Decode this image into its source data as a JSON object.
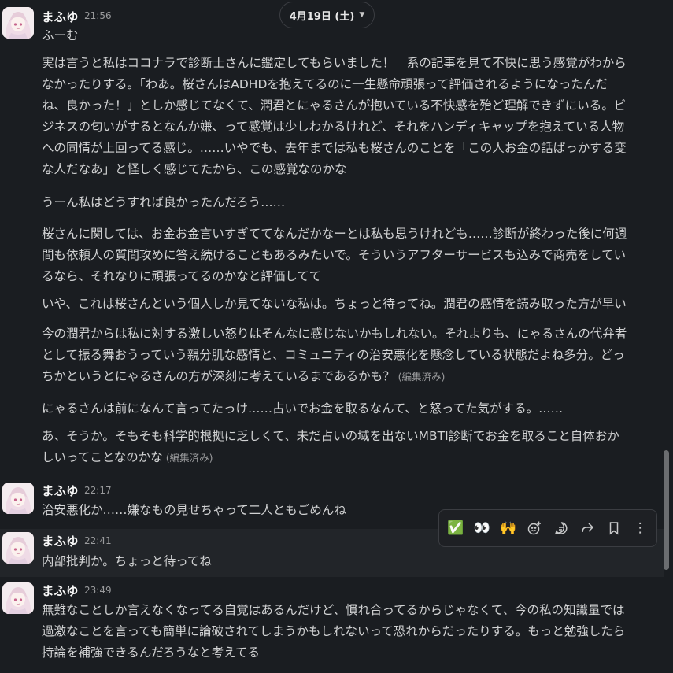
{
  "date_divider": {
    "label": "4月19日 (土)",
    "chevron": "chevron-down-icon"
  },
  "messages": [
    {
      "author": "まふゆ",
      "time": "21:56",
      "paragraphs": [
        {
          "lines": [
            "ふーむ"
          ]
        },
        {
          "lines": [
            "実は言うと私はココナラで診断士さんに鑑定してもらいました！　系の記事を見て不快に思う感覚がわから",
            "なかったりする。「わあ。桜さんはADHDを抱えてるのに一生懸命頑張って評価されるようになったんだ",
            "ね、良かった！」としか感じてなくて、潤君とにゃるさんが抱いている不快感を殆ど理解できずにいる。ビ",
            "ジネスの匂いがするとなんか嫌、って感覚は少しわかるけれど、それをハンディキャップを抱えている人物",
            "への同情が上回ってる感じ。……いやでも、去年までは私も桜さんのことを「この人お金の話ばっかする変",
            "な人だなあ」と怪しく感じてたから、この感覚なのかな"
          ]
        },
        {
          "lines": [
            "うーん私はどうすれば良かったんだろう……"
          ]
        },
        {
          "lines": [
            "桜さんに関しては、お金お金言いすぎててなんだかなーとは私も思うけれども……診断が終わった後に何週",
            "間も依頼人の質問攻めに答え続けることもあるみたいで。そういうアフターサービスも込みで商売をしてい",
            "るなら、それなりに頑張ってるのかなと評価してて"
          ]
        },
        {
          "lines": [
            "いや、これは桜さんという個人しか見てないな私は。ちょっと待ってね。潤君の感情を読み取った方が早い"
          ]
        },
        {
          "lines": [
            "今の潤君からは私に対する激しい怒りはそんなに感じないかもしれない。それよりも、にゃるさんの代弁者",
            "として振る舞おうっていう親分肌な感情と、コミュニティの治安悪化を懸念している状態だよね多分。どっ",
            "ちかというとにゃるさんの方が深刻に考えているまであるかも？"
          ],
          "edited": "(編集済み)"
        },
        {
          "lines": [
            "にゃるさんは前になんて言ってたっけ……占いでお金を取るなんて、と怒ってた気がする。……"
          ]
        },
        {
          "lines": [
            "あ、そうか。そもそも科学的根拠に乏しくて、未だ占いの域を出ないMBTI診断でお金を取ること自体おか",
            "しいってことなのかな"
          ],
          "edited": "(編集済み)"
        }
      ]
    },
    {
      "author": "まふゆ",
      "time": "22:17",
      "paragraphs": [
        {
          "lines": [
            "治安悪化か……嫌なもの見せちゃって二人ともごめんね"
          ]
        }
      ]
    },
    {
      "author": "まふゆ",
      "time": "22:41",
      "paragraphs": [
        {
          "lines": [
            "内部批判か。ちょっと待ってね"
          ]
        }
      ]
    },
    {
      "author": "まふゆ",
      "time": "23:49",
      "paragraphs": [
        {
          "lines": [
            "無難なことしか言えなくなってる自覚はあるんだけど、慣れ合ってるからじゃなくて、今の私の知識量では",
            "過激なことを言っても簡単に論破されてしまうかもしれないって恐れからだったりする。もっと勉強したら",
            "持論を補強できるんだろうなと考えてる"
          ]
        }
      ]
    }
  ],
  "toolbar": {
    "items": [
      {
        "name": "reaction-check-mark",
        "glyph": "✅"
      },
      {
        "name": "reaction-eyes",
        "glyph": "👀"
      },
      {
        "name": "reaction-raised-hands",
        "glyph": "🙌"
      },
      {
        "name": "add-reaction-icon",
        "glyph": ""
      },
      {
        "name": "reply-in-thread-icon",
        "glyph": ""
      },
      {
        "name": "forward-icon",
        "glyph": ""
      },
      {
        "name": "bookmark-icon",
        "glyph": ""
      },
      {
        "name": "more-actions-icon",
        "glyph": "⋮"
      }
    ]
  },
  "colors": {
    "background": "#1a1d21",
    "hover_background": "#222529",
    "text": "#d1d2d3",
    "timestamp": "#9a9b9d"
  }
}
